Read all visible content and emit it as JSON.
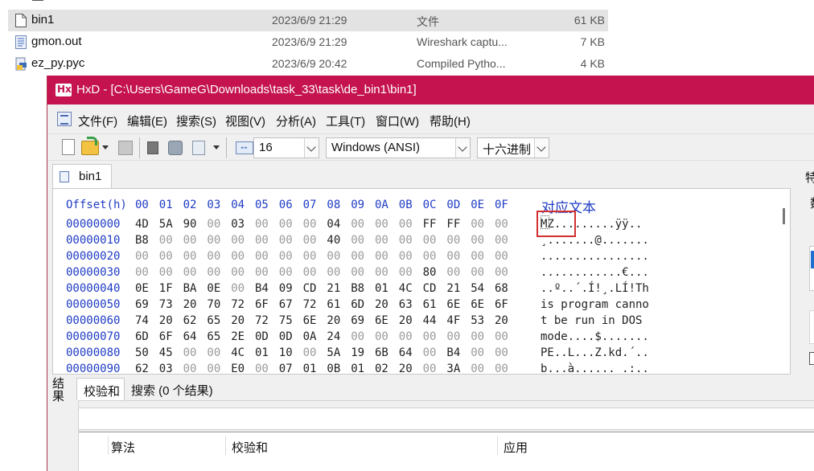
{
  "explorer": {
    "rows": [
      {
        "name": "bin1",
        "date": "2023/6/9 21:29",
        "type": "文件",
        "size": "61 KB",
        "selected": true,
        "icon": "blank-file-icon"
      },
      {
        "name": "gmon.out",
        "date": "2023/6/9 21:29",
        "type": "Wireshark captu...",
        "size": "7 KB",
        "selected": false,
        "icon": "capture-file-icon"
      },
      {
        "name": "ez_py.pyc",
        "date": "2023/6/9 20:42",
        "type": "Compiled Pytho...",
        "size": "4 KB",
        "selected": false,
        "icon": "python-file-icon"
      }
    ]
  },
  "window": {
    "title": "HxD - [C:\\Users\\GameG\\Downloads\\task_33\\task\\de_bin1\\bin1]",
    "title_color": "#c4134f"
  },
  "menu": [
    "文件(F)",
    "编辑(E)",
    "搜索(S)",
    "视图(V)",
    "分析(A)",
    "工具(T)",
    "窗口(W)",
    "帮助(H)"
  ],
  "toolbar": {
    "bytes_per_row": "16",
    "charset": "Windows (ANSI)",
    "display_mode": "十六进制"
  },
  "tab": {
    "label": "bin1"
  },
  "hex": {
    "offset_header": "Offset(h)",
    "columns": [
      "00",
      "01",
      "02",
      "03",
      "04",
      "05",
      "06",
      "07",
      "08",
      "09",
      "0A",
      "0B",
      "0C",
      "0D",
      "0E",
      "0F"
    ],
    "text_header": "对应文本",
    "rows": [
      {
        "offset": "00000000",
        "bytes": [
          "4D",
          "5A",
          "90",
          "00",
          "03",
          "00",
          "00",
          "00",
          "04",
          "00",
          "00",
          "00",
          "FF",
          "FF",
          "00",
          "00"
        ],
        "text": "MZ.........ÿÿ.."
      },
      {
        "offset": "00000010",
        "bytes": [
          "B8",
          "00",
          "00",
          "00",
          "00",
          "00",
          "00",
          "00",
          "40",
          "00",
          "00",
          "00",
          "00",
          "00",
          "00",
          "00"
        ],
        "text": "¸.......@......."
      },
      {
        "offset": "00000020",
        "bytes": [
          "00",
          "00",
          "00",
          "00",
          "00",
          "00",
          "00",
          "00",
          "00",
          "00",
          "00",
          "00",
          "00",
          "00",
          "00",
          "00"
        ],
        "text": "................"
      },
      {
        "offset": "00000030",
        "bytes": [
          "00",
          "00",
          "00",
          "00",
          "00",
          "00",
          "00",
          "00",
          "00",
          "00",
          "00",
          "00",
          "80",
          "00",
          "00",
          "00"
        ],
        "text": "............€..."
      },
      {
        "offset": "00000040",
        "bytes": [
          "0E",
          "1F",
          "BA",
          "0E",
          "00",
          "B4",
          "09",
          "CD",
          "21",
          "B8",
          "01",
          "4C",
          "CD",
          "21",
          "54",
          "68"
        ],
        "text": "..º..´.Í!¸.LÍ!Th"
      },
      {
        "offset": "00000050",
        "bytes": [
          "69",
          "73",
          "20",
          "70",
          "72",
          "6F",
          "67",
          "72",
          "61",
          "6D",
          "20",
          "63",
          "61",
          "6E",
          "6E",
          "6F"
        ],
        "text": "is program canno"
      },
      {
        "offset": "00000060",
        "bytes": [
          "74",
          "20",
          "62",
          "65",
          "20",
          "72",
          "75",
          "6E",
          "20",
          "69",
          "6E",
          "20",
          "44",
          "4F",
          "53",
          "20"
        ],
        "text": "t be run in DOS "
      },
      {
        "offset": "00000070",
        "bytes": [
          "6D",
          "6F",
          "64",
          "65",
          "2E",
          "0D",
          "0D",
          "0A",
          "24",
          "00",
          "00",
          "00",
          "00",
          "00",
          "00",
          "00"
        ],
        "text": "mode....$......."
      },
      {
        "offset": "00000080",
        "bytes": [
          "50",
          "45",
          "00",
          "00",
          "4C",
          "01",
          "10",
          "00",
          "5A",
          "19",
          "6B",
          "64",
          "00",
          "B4",
          "00",
          "00"
        ],
        "text": "PE..L...Z.kd.´.."
      },
      {
        "offset": "00000090",
        "bytes": [
          "62",
          "03",
          "00",
          "00",
          "E0",
          "00",
          "07",
          "01",
          "0B",
          "01",
          "02",
          "20",
          "00",
          "3A",
          "00",
          "00"
        ],
        "text": "b...à...... .:.."
      }
    ]
  },
  "side_panel": {
    "label_1": "特",
    "label_2": "数"
  },
  "results": {
    "title": "结果",
    "tabs": [
      "校验和",
      "搜索 (0 个结果)"
    ],
    "columns": [
      "算法",
      "校验和",
      "应用"
    ]
  },
  "colors": {
    "offset_blue": "#1f3cc4",
    "highlight_red": "#d23030",
    "zero_byte_grey": "#9a9a9a"
  }
}
